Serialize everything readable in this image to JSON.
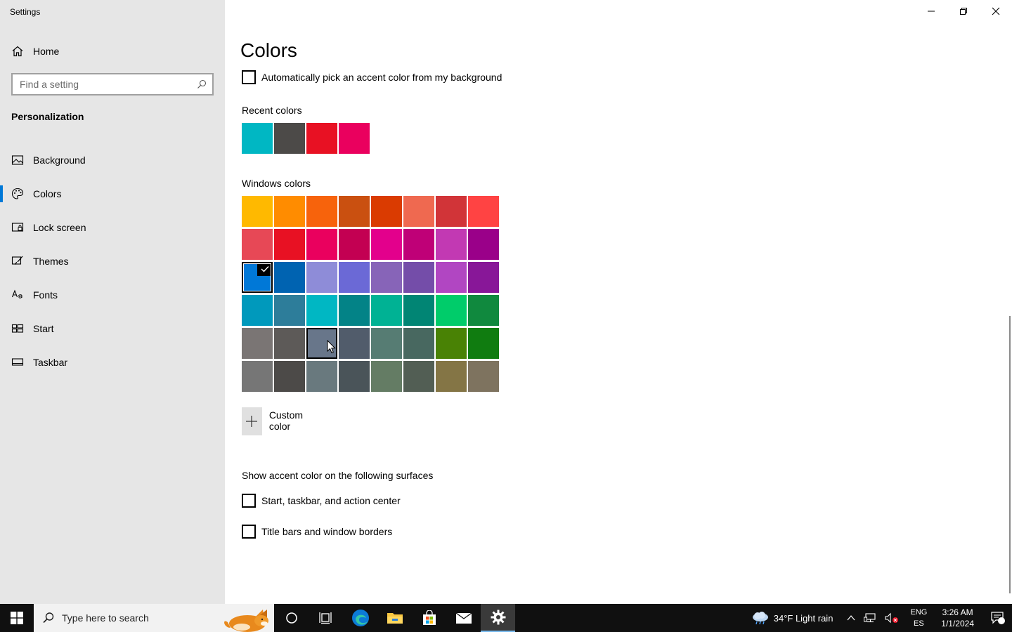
{
  "app": {
    "title": "Settings"
  },
  "sidebar": {
    "home_label": "Home",
    "search_placeholder": "Find a setting",
    "section_title": "Personalization",
    "items": [
      {
        "label": "Background",
        "icon": "image-icon"
      },
      {
        "label": "Colors",
        "icon": "palette-icon",
        "active": true
      },
      {
        "label": "Lock screen",
        "icon": "lock-screen-icon"
      },
      {
        "label": "Themes",
        "icon": "brush-icon"
      },
      {
        "label": "Fonts",
        "icon": "font-icon"
      },
      {
        "label": "Start",
        "icon": "start-icon"
      },
      {
        "label": "Taskbar",
        "icon": "taskbar-icon"
      }
    ]
  },
  "main": {
    "title": "Colors",
    "auto_pick_label": "Automatically pick an accent color from my background",
    "recent_label": "Recent colors",
    "recent_colors": [
      "#00b7c3",
      "#4c4a48",
      "#e81123",
      "#ea005e"
    ],
    "windows_label": "Windows colors",
    "windows_colors": [
      [
        "#ffb900",
        "#ff8c00",
        "#f7630c",
        "#ca5010",
        "#da3b01",
        "#ef6950",
        "#d13438",
        "#ff4343"
      ],
      [
        "#e74856",
        "#e81123",
        "#ea005e",
        "#c30052",
        "#e3008c",
        "#bf0077",
        "#c239b3",
        "#9a0089"
      ],
      [
        "#0078d7",
        "#0063b1",
        "#8e8cd8",
        "#6b69d6",
        "#8764b8",
        "#744da9",
        "#b146c2",
        "#881798"
      ],
      [
        "#0099bc",
        "#2d7d9a",
        "#00b7c3",
        "#038387",
        "#00b294",
        "#018574",
        "#00cc6a",
        "#10893e"
      ],
      [
        "#7a7574",
        "#5d5a58",
        "#68768a",
        "#515c6b",
        "#567c73",
        "#486860",
        "#498205",
        "#107c10"
      ],
      [
        "#767676",
        "#4c4a48",
        "#69797e",
        "#4a5459",
        "#647c64",
        "#525e54",
        "#847545",
        "#7e735f"
      ]
    ],
    "custom_color_label": "Custom color",
    "surfaces_label": "Show accent color on the following surfaces",
    "surface_start_label": "Start, taskbar, and action center",
    "surface_titlebars_label": "Title bars and window borders"
  },
  "taskbar": {
    "search_placeholder": "Type here to search",
    "weather": "34°F  Light rain",
    "lang_top": "ENG",
    "lang_bottom": "ES",
    "time": "3:26 AM",
    "date": "1/1/2024",
    "notification_count": "1"
  }
}
